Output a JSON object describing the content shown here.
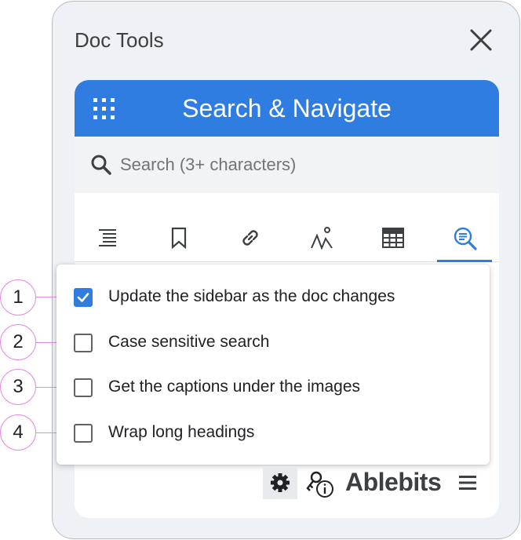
{
  "panel": {
    "title": "Doc Tools"
  },
  "header": {
    "title": "Search & Navigate",
    "color": "#2f7de1"
  },
  "search": {
    "placeholder": "Search (3+ characters)",
    "value": ""
  },
  "tabs": [
    {
      "icon": "headings-list-icon",
      "active": false
    },
    {
      "icon": "bookmark-icon",
      "active": false
    },
    {
      "icon": "link-icon",
      "active": false
    },
    {
      "icon": "image-icon",
      "active": false
    },
    {
      "icon": "table-icon",
      "active": false
    },
    {
      "icon": "search-results-icon",
      "active": true
    }
  ],
  "options": [
    {
      "label": "Update the sidebar as the doc changes",
      "checked": true
    },
    {
      "label": "Case sensitive search",
      "checked": false
    },
    {
      "label": "Get the captions under the images",
      "checked": false
    },
    {
      "label": "Wrap long headings",
      "checked": false
    }
  ],
  "callouts": [
    "1",
    "2",
    "3",
    "4"
  ],
  "footer": {
    "brand": "Ablebits"
  }
}
